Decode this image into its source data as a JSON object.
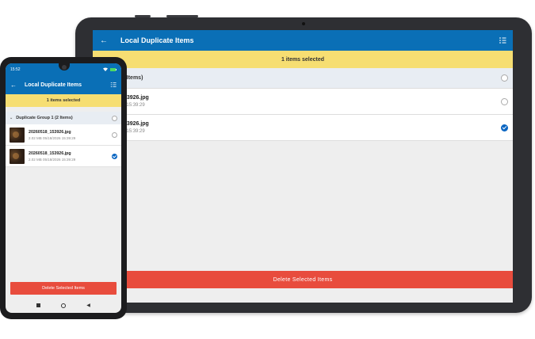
{
  "tablet": {
    "app_title": "Local Duplicate Items",
    "selected_banner": "1 items selected",
    "group_label": "e Group 1 (2 Items)",
    "items": [
      {
        "name": "20260518_153926.jpg",
        "meta": "MB  05/18/2026 15:39:29",
        "selected": false
      },
      {
        "name": "20260518_153926.jpg",
        "meta": "MB  05/18/2026 15:39:29",
        "selected": true
      }
    ],
    "delete_label": "Delete Selected Items"
  },
  "phone": {
    "status_time": "15:52",
    "app_title": "Local Duplicate Items",
    "selected_banner": "1 items selected",
    "group_label": "Duplicate Group 1 (2 Items)",
    "items": [
      {
        "name": "20260518_153926.jpg",
        "meta": "2.02 MB  05/18/2026 15:39:29",
        "selected": false
      },
      {
        "name": "20260518_153926.jpg",
        "meta": "2.02 MB  05/18/2026 15:39:29",
        "selected": true
      }
    ],
    "delete_label": "Delete Selected Items"
  },
  "colors": {
    "appbar": "#0a6fb6",
    "banner": "#f6de72",
    "delete": "#e84c3d",
    "check": "#0a66c2"
  },
  "icons": [
    "back-arrow-icon",
    "checklist-icon",
    "radio-unchecked-icon",
    "radio-checked-icon",
    "chevron-down-icon",
    "wifi-icon",
    "battery-icon"
  ]
}
